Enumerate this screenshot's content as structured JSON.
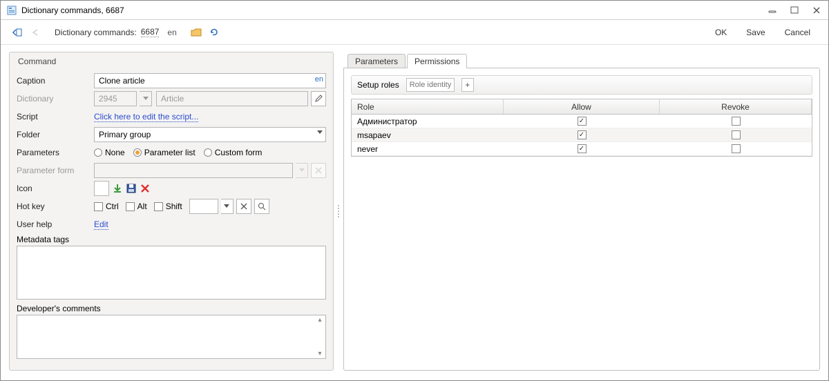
{
  "window": {
    "title": "Dictionary commands, 6687"
  },
  "toolbar": {
    "breadcrumb_label": "Dictionary commands:",
    "breadcrumb_id": "6687",
    "breadcrumb_lang": "en",
    "ok": "OK",
    "save": "Save",
    "cancel": "Cancel"
  },
  "form": {
    "panel_header": "Command",
    "caption_label": "Caption",
    "caption_value": "Clone article",
    "caption_lang": "en",
    "dictionary_label": "Dictionary",
    "dictionary_id": "2945",
    "dictionary_name": "Article",
    "script_label": "Script",
    "script_link": "Click here to edit the script...",
    "folder_label": "Folder",
    "folder_value": "Primary group",
    "parameters_label": "Parameters",
    "param_none": "None",
    "param_list": "Parameter list",
    "param_custom": "Custom form",
    "param_form_label": "Parameter form",
    "icon_label": "Icon",
    "hotkey_label": "Hot key",
    "hk_ctrl": "Ctrl",
    "hk_alt": "Alt",
    "hk_shift": "Shift",
    "userhelp_label": "User help",
    "userhelp_link": "Edit",
    "metadata_label": "Metadata tags",
    "devcomments_label": "Developer's comments"
  },
  "tabs": {
    "parameters": "Parameters",
    "permissions": "Permissions"
  },
  "permissions": {
    "setup_label": "Setup roles",
    "role_placeholder": "Role identity",
    "col_role": "Role",
    "col_allow": "Allow",
    "col_revoke": "Revoke",
    "rows": [
      {
        "role": "Администратор",
        "allow": true,
        "revoke": false
      },
      {
        "role": "msapaev",
        "allow": true,
        "revoke": false
      },
      {
        "role": "never",
        "allow": true,
        "revoke": false
      }
    ]
  }
}
